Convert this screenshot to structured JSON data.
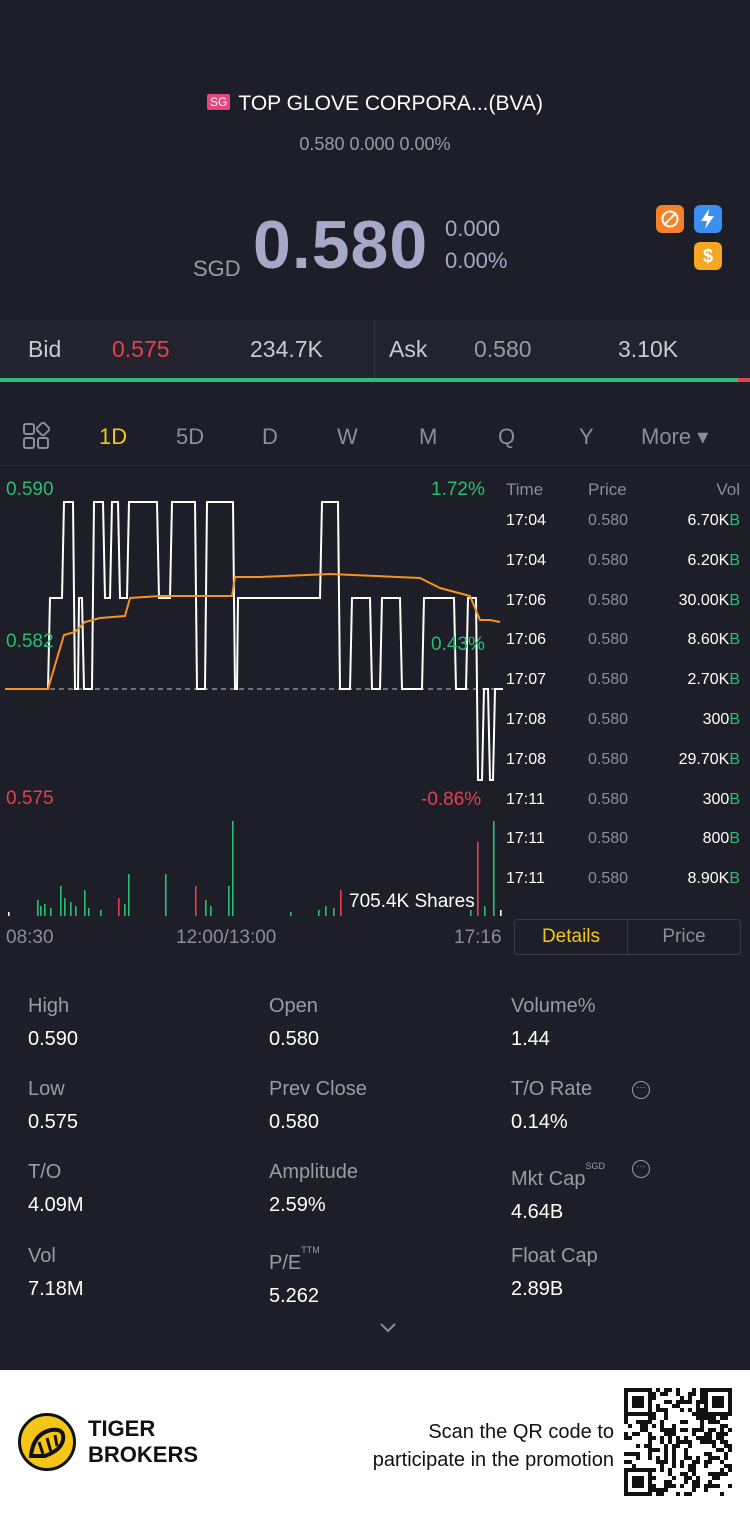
{
  "header": {
    "market_badge": "SG",
    "title": "TOP GLOVE CORPORA...(BVA)",
    "subtitle": "0.580 0.000 0.00%",
    "currency": "SGD",
    "price": "0.580",
    "change": "0.000",
    "change_pct": "0.00%",
    "icons": [
      "no-short-icon",
      "flash-icon",
      "dollar-icon"
    ],
    "accent_color": "#a6a8c7"
  },
  "bidask": {
    "bid_label": "Bid",
    "bid_price": "0.575",
    "bid_size": "234.7K",
    "ask_label": "Ask",
    "ask_price": "0.580",
    "ask_size": "3.10K",
    "bid_color": "#e83f4e",
    "buy_ratio": 0.984
  },
  "tabs": [
    {
      "label": "1D",
      "active": true
    },
    {
      "label": "5D"
    },
    {
      "label": "D"
    },
    {
      "label": "W"
    },
    {
      "label": "M"
    },
    {
      "label": "Q"
    },
    {
      "label": "Y"
    },
    {
      "label": "More ▾"
    }
  ],
  "chart": {
    "price_high": "0.590",
    "price_mid": "0.582",
    "price_low": "0.575",
    "pct_high": "1.72%",
    "pct_mid": "0.43%",
    "pct_low": "-0.86%",
    "volume_label": "705.4K Shares",
    "time_start": "08:30",
    "time_mid": "12:00/13:00",
    "time_end": "17:16",
    "colors": {
      "up": "#2bbd72",
      "down": "#e83f4e",
      "price_line": "#ffffff",
      "avg_line": "#f5931e"
    }
  },
  "ticks": {
    "headers": {
      "time": "Time",
      "price": "Price",
      "vol": "Vol"
    },
    "rows": [
      {
        "time": "17:04",
        "price": "0.580",
        "vol": "6.70K",
        "side": "B"
      },
      {
        "time": "17:04",
        "price": "0.580",
        "vol": "6.20K",
        "side": "B"
      },
      {
        "time": "17:06",
        "price": "0.580",
        "vol": "30.00K",
        "side": "B"
      },
      {
        "time": "17:06",
        "price": "0.580",
        "vol": "8.60K",
        "side": "B"
      },
      {
        "time": "17:07",
        "price": "0.580",
        "vol": "2.70K",
        "side": "B"
      },
      {
        "time": "17:08",
        "price": "0.580",
        "vol": "300",
        "side": "B"
      },
      {
        "time": "17:08",
        "price": "0.580",
        "vol": "29.70K",
        "side": "B"
      },
      {
        "time": "17:11",
        "price": "0.580",
        "vol": "300",
        "side": "B"
      },
      {
        "time": "17:11",
        "price": "0.580",
        "vol": "800",
        "side": "B"
      },
      {
        "time": "17:11",
        "price": "0.580",
        "vol": "8.90K",
        "side": "B"
      }
    ],
    "details_label": "Details",
    "price_label": "Price"
  },
  "stats": {
    "high": {
      "label": "High",
      "value": "0.590"
    },
    "open": {
      "label": "Open",
      "value": "0.580"
    },
    "volume_pct": {
      "label": "Volume%",
      "value": "1.44"
    },
    "low": {
      "label": "Low",
      "value": "0.575"
    },
    "prev_close": {
      "label": "Prev Close",
      "value": "0.580"
    },
    "to_rate": {
      "label": "T/O Rate",
      "value": "0.14%"
    },
    "to": {
      "label": "T/O",
      "value": "4.09M"
    },
    "amplitude": {
      "label": "Amplitude",
      "value": "2.59%"
    },
    "mkt_cap": {
      "label": "Mkt Cap",
      "sup": "SGD",
      "value": "4.64B"
    },
    "vol": {
      "label": "Vol",
      "value": "7.18M"
    },
    "pe": {
      "label": "P/E",
      "sup": "TTM",
      "value": "5.262"
    },
    "float_cap": {
      "label": "Float Cap",
      "value": "2.89B"
    }
  },
  "footer": {
    "brand_line1": "TIGER",
    "brand_line2": "BROKERS",
    "scan_line1": "Scan the QR code to",
    "scan_line2": "participate in the promotion"
  }
}
